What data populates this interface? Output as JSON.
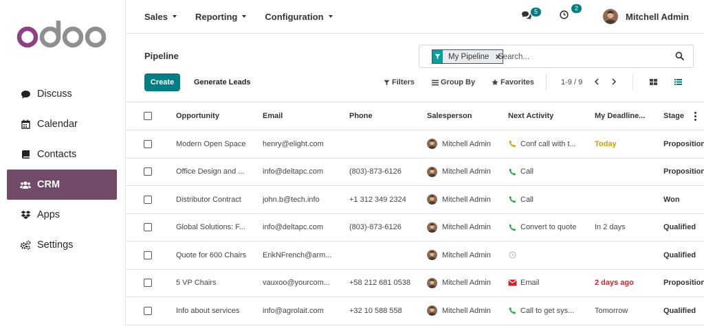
{
  "sidebar": {
    "logo": "odoo",
    "items": [
      {
        "label": "Discuss",
        "icon": "comments-icon"
      },
      {
        "label": "Calendar",
        "icon": "calendar-icon"
      },
      {
        "label": "Contacts",
        "icon": "address-book-icon"
      },
      {
        "label": "CRM",
        "icon": "users-icon",
        "active": true
      },
      {
        "label": "Apps",
        "icon": "dropbox-icon"
      },
      {
        "label": "Settings",
        "icon": "cogs-icon"
      }
    ]
  },
  "topbar": {
    "menu": [
      "Sales",
      "Reporting",
      "Configuration"
    ],
    "messages_count": "5",
    "activities_count": "2",
    "user_name": "Mitchell Admin"
  },
  "control_panel": {
    "breadcrumb": "Pipeline",
    "search_facet": "My Pipeline",
    "search_placeholder": "Search...",
    "create_label": "Create",
    "generate_leads_label": "Generate Leads",
    "filters_label": "Filters",
    "group_by_label": "Group By",
    "favorites_label": "Favorites",
    "pager": "1-9 / 9"
  },
  "table": {
    "columns": [
      "Opportunity",
      "Email",
      "Phone",
      "Salesperson",
      "Next Activity",
      "My Deadline...",
      "Stage"
    ],
    "rows": [
      {
        "opportunity": "Modern Open Space",
        "email": "henry@elight.com",
        "phone": "",
        "salesperson": "Mitchell Admin",
        "activity_icon": "phone-icon",
        "activity": "Conf call with t...",
        "deadline": "Today",
        "stage": "Proposition"
      },
      {
        "opportunity": "Office Design and ...",
        "email": "info@deltapc.com",
        "phone": "(803)-873-6126",
        "salesperson": "Mitchell Admin",
        "activity_icon": "phone-icon",
        "activity": "Call",
        "deadline": "",
        "stage": "Proposition"
      },
      {
        "opportunity": "Distributor Contract",
        "email": "john.b@tech.info",
        "phone": "+1 312 349 2324",
        "salesperson": "Mitchell Admin",
        "activity_icon": "phone-icon",
        "activity": "Call",
        "deadline": "",
        "stage": "Won"
      },
      {
        "opportunity": "Global Solutions: F...",
        "email": "info@deltapc.com",
        "phone": "(803)-873-6126",
        "salesperson": "Mitchell Admin",
        "activity_icon": "phone-icon",
        "activity": "Convert to quote",
        "deadline": "In 2 days",
        "stage": "Qualified"
      },
      {
        "opportunity": "Quote for 600 Chairs",
        "email": "ErikNFrench@arm...",
        "phone": "",
        "salesperson": "Mitchell Admin",
        "activity_icon": "clock-icon",
        "activity": "",
        "deadline": "",
        "stage": "Qualified"
      },
      {
        "opportunity": "5 VP Chairs",
        "email": "vauxoo@yourcom...",
        "phone": "+58 212 681 0538",
        "salesperson": "Mitchell Admin",
        "activity_icon": "envelope-icon",
        "activity": "Email",
        "deadline": "2 days ago",
        "stage": "Proposition"
      },
      {
        "opportunity": "Info about services",
        "email": "info@agrolait.com",
        "phone": "+32 10 588 558",
        "salesperson": "Mitchell Admin",
        "activity_icon": "phone-icon",
        "activity": "Call to get sys...",
        "deadline": "Tomorrow",
        "stage": "Qualified"
      }
    ]
  },
  "colors": {
    "brand": "#714b67",
    "primary": "#017e84",
    "today": "#d39e00",
    "overdue": "#c9252b",
    "phone_today": "#d39e00",
    "phone_planned": "#28a745"
  }
}
